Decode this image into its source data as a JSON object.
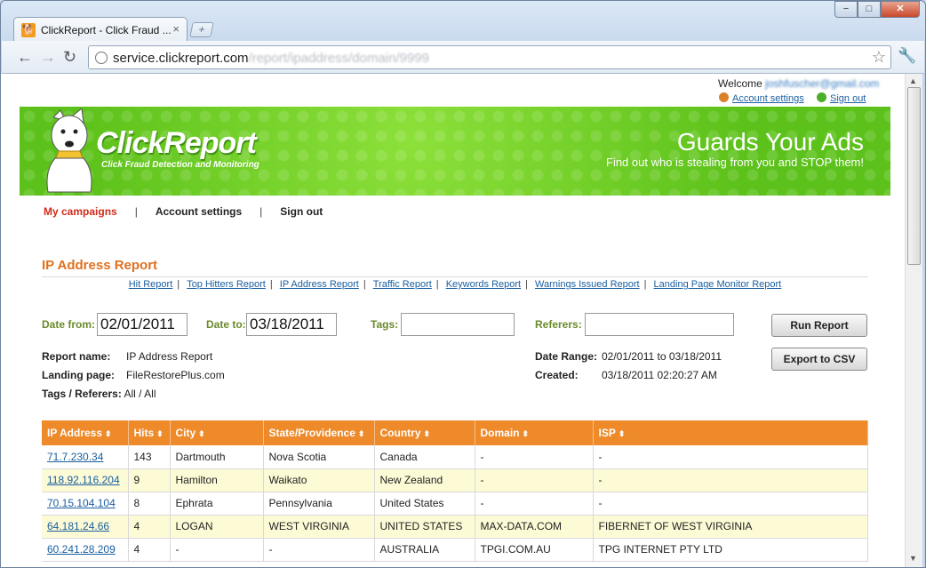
{
  "browser": {
    "tab_title": "ClickReport - Click Fraud ...",
    "tab_close": "×",
    "new_tab": "+",
    "url_host": "service.clickreport.com",
    "url_path": "/report/ipaddress/domain/9999",
    "win_min": "−",
    "win_max": "□",
    "win_close": "✕"
  },
  "account": {
    "welcome_label": "Welcome",
    "email": "joshfuscher@gmail.com",
    "settings": "Account settings",
    "signout": "Sign out"
  },
  "banner": {
    "logo": "ClickReport",
    "logo_sub": "Click Fraud Detection and Monitoring",
    "headline": "Guards Your Ads",
    "tagline": "Find out who is stealing from you and STOP them!"
  },
  "mainnav": {
    "campaigns": "My campaigns",
    "settings": "Account settings",
    "signout": "Sign out",
    "sep": "|"
  },
  "report": {
    "heading": "IP Address Report",
    "subnav": [
      "Hit Report",
      "Top Hitters Report",
      "IP Address Report",
      "Traffic Report",
      "Keywords Report",
      "Warnings Issued Report",
      "Landing Page Monitor Report"
    ],
    "date_from_label": "Date from:",
    "date_from": "02/01/2011",
    "date_to_label": "Date to:",
    "date_to": "03/18/2011",
    "tags_label": "Tags:",
    "referers_label": "Referers:",
    "run_button": "Run Report",
    "export_button": "Export to CSV",
    "name_label": "Report name:",
    "name": "IP Address Report",
    "landing_label": "Landing page:",
    "landing": "FileRestorePlus.com",
    "tags_ref_label": "Tags / Referers:",
    "tags_ref": "All / All",
    "range_label": "Date Range:",
    "range": "02/01/2011 to 03/18/2011",
    "created_label": "Created:",
    "created": "03/18/2011 02:20:27 AM"
  },
  "table": {
    "headers": [
      "IP Address",
      "Hits",
      "City",
      "State/Providence",
      "Country",
      "Domain",
      "ISP"
    ],
    "sort_glyph": "⬍",
    "rows": [
      [
        "71.7.230.34",
        "143",
        "Dartmouth",
        "Nova Scotia",
        "Canada",
        "-",
        "-"
      ],
      [
        "118.92.116.204",
        "9",
        "Hamilton",
        "Waikato",
        "New Zealand",
        "-",
        "-"
      ],
      [
        "70.15.104.104",
        "8",
        "Ephrata",
        "Pennsylvania",
        "United States",
        "-",
        "-"
      ],
      [
        "64.181.24.66",
        "4",
        "LOGAN",
        "WEST VIRGINIA",
        "UNITED STATES",
        "MAX-DATA.COM",
        "FIBERNET OF WEST VIRGINIA"
      ],
      [
        "60.241.28.209",
        "4",
        "-",
        "-",
        "AUSTRALIA",
        "TPGI.COM.AU",
        "TPG INTERNET PTY LTD"
      ]
    ]
  },
  "colors": {
    "accent_orange": "#ee8a2a",
    "banner_green": "#6acb22",
    "active_red": "#d22c1c",
    "link_blue": "#1a5fa0"
  }
}
